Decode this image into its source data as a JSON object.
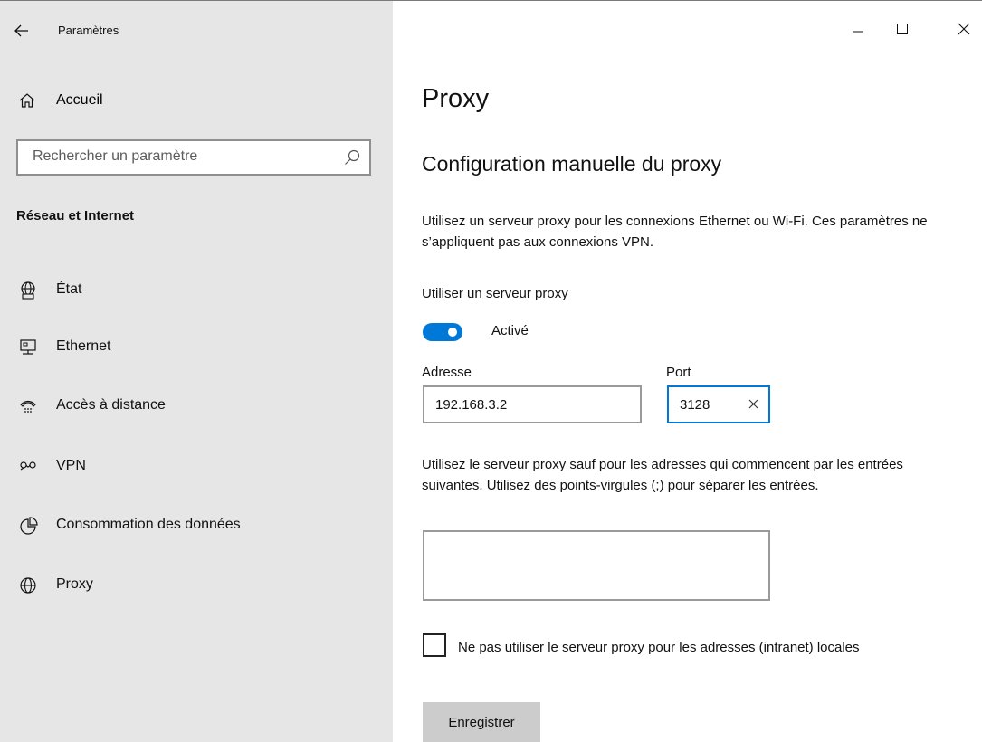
{
  "window": {
    "title": "Paramètres",
    "back_icon": "back-arrow-icon",
    "minimize_icon": "minimize-icon",
    "maximize_icon": "maximize-icon",
    "close_icon": "close-icon"
  },
  "sidebar": {
    "home_label": "Accueil",
    "search": {
      "placeholder": "Rechercher un paramètre"
    },
    "section_heading": "Réseau et Internet",
    "items": [
      {
        "label": "État",
        "icon": "globe-status-icon"
      },
      {
        "label": "Ethernet",
        "icon": "ethernet-icon"
      },
      {
        "label": "Accès à distance",
        "icon": "dialup-icon"
      },
      {
        "label": "VPN",
        "icon": "vpn-icon"
      },
      {
        "label": "Consommation des données",
        "icon": "data-usage-icon"
      },
      {
        "label": "Proxy",
        "icon": "globe-icon"
      }
    ]
  },
  "main": {
    "title": "Proxy",
    "subtitle": "Configuration manuelle du proxy",
    "description": "Utilisez un serveur proxy pour les connexions Ethernet ou Wi-Fi. Ces paramètres ne s’appliquent pas aux connexions VPN.",
    "use_proxy_label": "Utiliser un serveur proxy",
    "toggle": {
      "state_label": "Activé",
      "on": true,
      "color": "#0078d7"
    },
    "address": {
      "label": "Adresse",
      "value": "192.168.3.2"
    },
    "port": {
      "label": "Port",
      "value": "3128"
    },
    "exceptions_description": "Utilisez le serveur proxy sauf pour les adresses qui commencent par les entrées suivantes. Utilisez des points-virgules (;) pour séparer les entrées.",
    "exceptions_value": "",
    "local_checkbox": {
      "label": "Ne pas utiliser le serveur proxy pour les adresses (intranet) locales",
      "checked": false
    },
    "save_label": "Enregistrer"
  }
}
